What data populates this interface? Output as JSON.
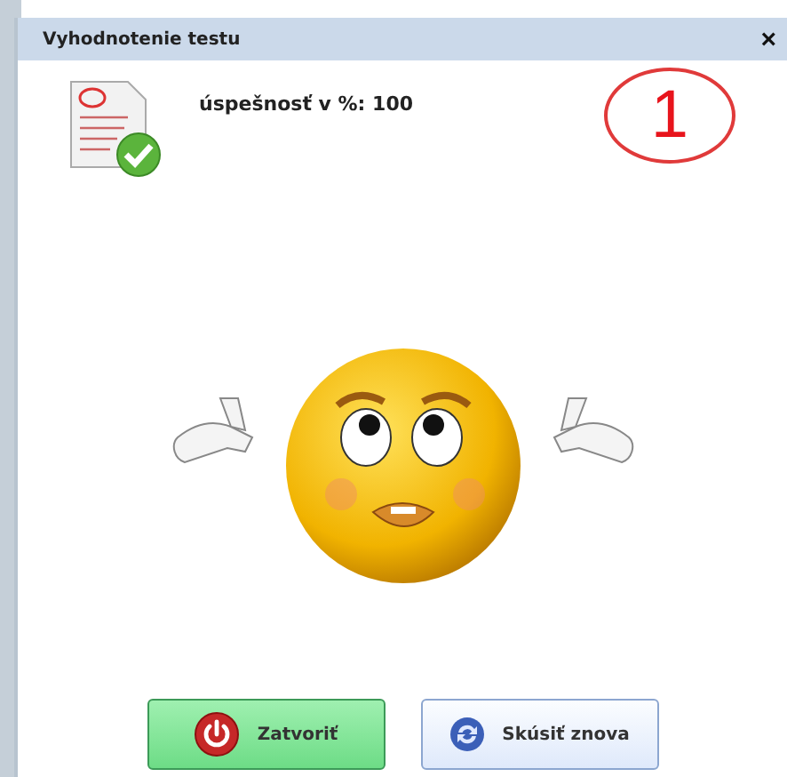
{
  "dialog": {
    "title": "Vyhodnotenie testu",
    "close": "×"
  },
  "result": {
    "score": "úspešnosť v %: 100"
  },
  "annotation": {
    "number": "1"
  },
  "buttons": [
    {
      "label": "Zatvoriť",
      "kind": "close"
    },
    {
      "label": "Skúsiť znova",
      "kind": "retry"
    }
  ]
}
